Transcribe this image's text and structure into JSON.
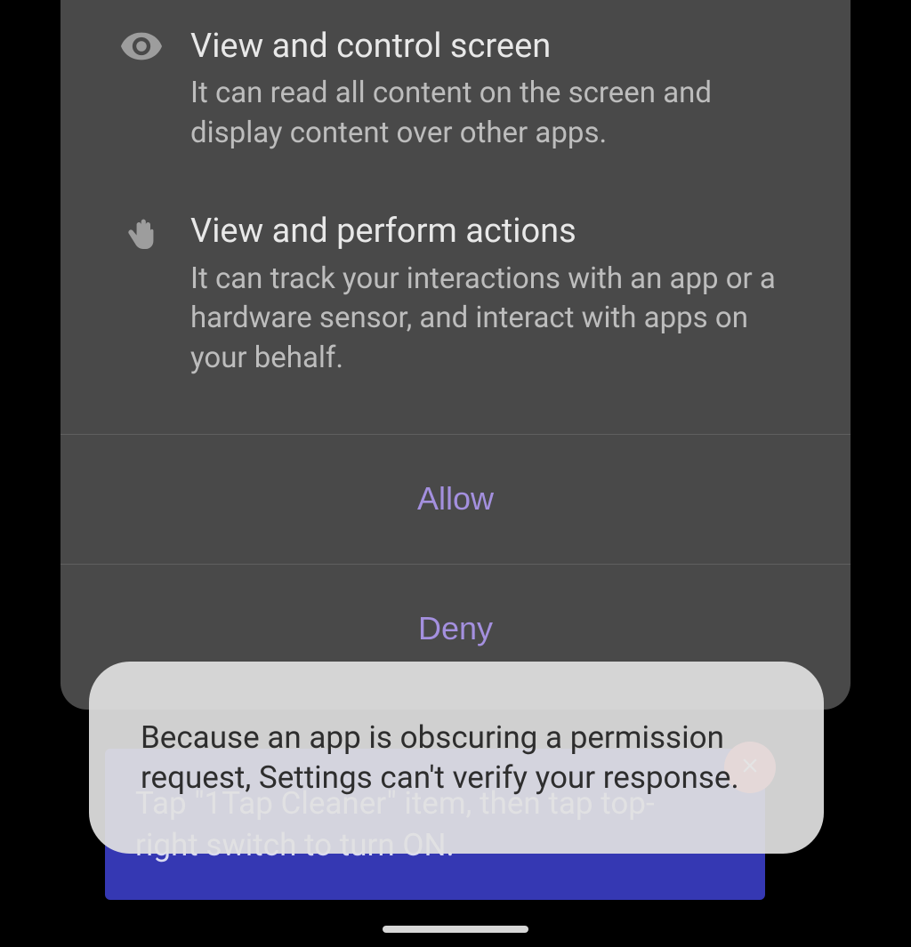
{
  "permissions": [
    {
      "title": "View and control screen",
      "description": "It can read all content on the screen and display content over other apps."
    },
    {
      "title": "View and perform actions",
      "description": "It can track your interactions with an app or a hardware sensor, and interact with apps on your behalf."
    }
  ],
  "buttons": {
    "allow": "Allow",
    "deny": "Deny"
  },
  "hint": {
    "text": "Tap \"1Tap Cleaner\" item, then tap top-right switch to turn ON."
  },
  "toast": {
    "message": "Because an app is obscuring a permission request, Settings can't verify your response."
  }
}
